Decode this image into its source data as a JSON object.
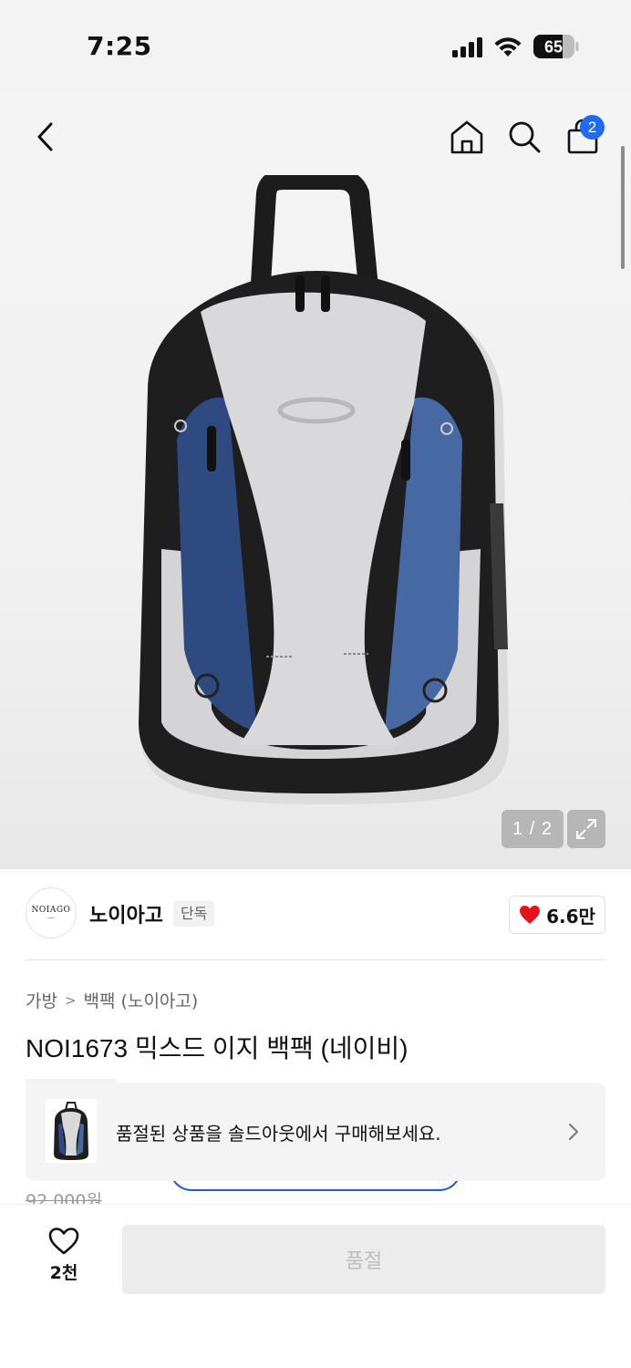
{
  "status_bar": {
    "time": "7:25",
    "battery": "65"
  },
  "header": {
    "icons": [
      "back-arrow-icon",
      "home-icon",
      "search-icon",
      "shopping-bag-icon"
    ],
    "cart_count": "2"
  },
  "gallery": {
    "page_counter": "1 / 2"
  },
  "brand": {
    "logo_text": "NOIAGO",
    "name": "노이아고",
    "badge": "단독",
    "like_count": "6.6만"
  },
  "breadcrumb": {
    "category": "가방",
    "subcategory": "백팩 (노이아고)"
  },
  "product": {
    "title": "NOI1673 믹스드 이지 백팩 (네이비)",
    "original_price": "92,000원"
  },
  "soldout_banner": {
    "text": "품절된 상품을 솔드아웃에서 구매해보세요."
  },
  "bottom_bar": {
    "wishlist_count": "2천",
    "action_label": "품절"
  },
  "colors": {
    "accent": "#1f6bf5",
    "heart": "#e8141b"
  }
}
